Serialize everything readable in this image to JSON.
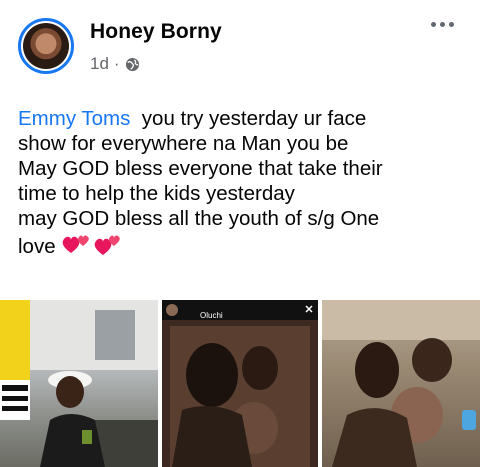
{
  "post": {
    "author": "Honey Borny",
    "time": "1d",
    "separator": "·",
    "mention": "Emmy Toms",
    "lines": [
      "you try yesterday ur face",
      "show for everywhere na Man you be",
      "May GOD bless everyone that take their",
      "time to help the kids yesterday",
      "may GOD bless all the youth of s/g One",
      "love"
    ],
    "privacy_icon": "globe-icon",
    "emoji": "two-hearts-emoji"
  },
  "photos": [
    {
      "name": "photo-1"
    },
    {
      "name": "photo-2",
      "overlay_name": "Oluchi"
    },
    {
      "name": "photo-3"
    }
  ],
  "colors": {
    "accent": "#1877f2",
    "meta": "#65676b",
    "text": "#050505"
  }
}
